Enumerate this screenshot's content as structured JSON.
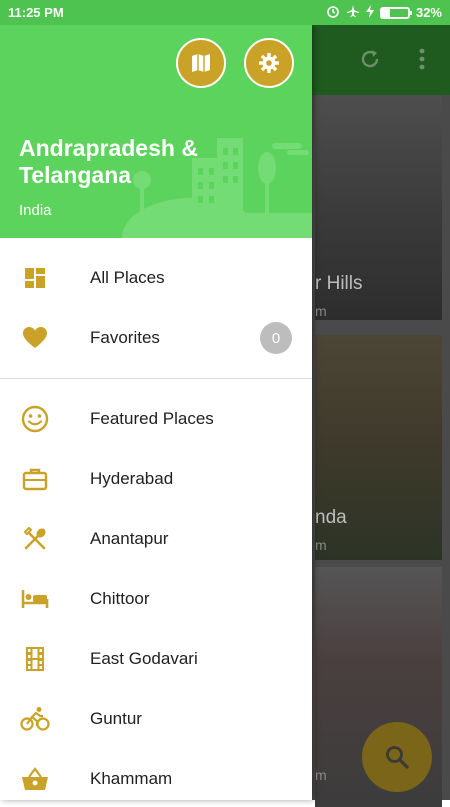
{
  "status": {
    "time": "11:25 PM",
    "battery": "32%",
    "battery_level": 0.32
  },
  "drawer": {
    "region": "Andrapradesh & Telangana",
    "country": "India",
    "header_buttons": [
      {
        "name": "map-icon"
      },
      {
        "name": "gear-icon"
      }
    ],
    "primary_items": [
      {
        "label": "All Places",
        "icon": "dashboard-icon"
      },
      {
        "label": "Favorites",
        "icon": "heart-icon",
        "badge": "0"
      }
    ],
    "category_items": [
      {
        "label": "Featured Places",
        "icon": "smiley-icon"
      },
      {
        "label": "Hyderabad",
        "icon": "briefcase-icon"
      },
      {
        "label": "Anantapur",
        "icon": "utensils-icon"
      },
      {
        "label": "Chittoor",
        "icon": "bed-icon"
      },
      {
        "label": "East Godavari",
        "icon": "film-icon"
      },
      {
        "label": "Guntur",
        "icon": "bicycle-icon"
      },
      {
        "label": "Khammam",
        "icon": "basket-icon"
      }
    ]
  },
  "background": {
    "cards": [
      {
        "title": "r Hills",
        "sub": "m"
      },
      {
        "title": "nda",
        "sub": "m"
      },
      {
        "title": "",
        "sub": "m"
      }
    ]
  },
  "colors": {
    "header": "#5cd35c",
    "accent": "#c9a227",
    "status_bar": "#4fc34f"
  }
}
